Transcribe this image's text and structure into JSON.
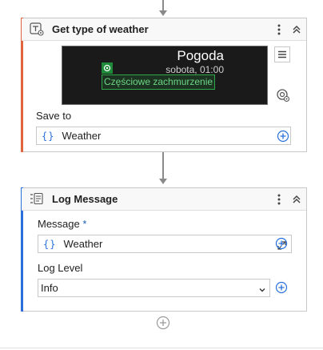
{
  "card1": {
    "title": "Get type of weather",
    "accent_color": "#e0643c",
    "icon": "text-target-icon",
    "preview": {
      "title": "Pogoda",
      "subtitle": "sobota, 01:00",
      "selected_text": "Częściowe zachmurzenie"
    },
    "save_to_label": "Save to",
    "save_to_value": "Weather"
  },
  "card2": {
    "title": "Log Message",
    "accent_color": "#2a6fdb",
    "icon": "log-message-icon",
    "message_label": "Message",
    "required_marker": "*",
    "message_value": "Weather",
    "log_level_label": "Log Level",
    "log_level_value": "Info"
  },
  "colors": {
    "variable_icon": "#2a6fdb",
    "selection_green": "#2ea84a",
    "connector": "#8a8a8a"
  }
}
